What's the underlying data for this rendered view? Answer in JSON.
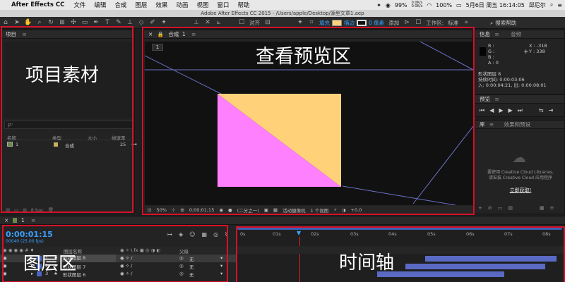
{
  "menubar": {
    "app_name": "After Effects CC",
    "items": [
      "文件",
      "编辑",
      "合成",
      "图层",
      "效果",
      "动画",
      "视图",
      "窗口",
      "帮助"
    ],
    "battery": "99%",
    "net_up": "0.0K/s",
    "net_down": "0.0K/s",
    "battery2": "100%",
    "datetime": "5月6日 周五  16:14:05",
    "user": "邱尼尔"
  },
  "window": {
    "title": "Adobe After Effects CC 2015 - /Users/apple/Desktop/源型文章1.aep"
  },
  "toolbar": {
    "align_label": "对齐",
    "fill_label": "填充",
    "stroke_label": "描边",
    "stroke_px": "0 像素",
    "add_label": "添加",
    "workspace_label": "工作区:",
    "workspace_value": "标准",
    "search_help": "搜索帮助"
  },
  "project": {
    "tab": "项目",
    "search_placeholder": "ρ·",
    "headers": {
      "name": "名称",
      "type": "类型",
      "size": "大小",
      "fps": "帧速率"
    },
    "rows": [
      {
        "name": "1",
        "type": "合成",
        "fps": "25"
      }
    ],
    "bpc": "8 bpc",
    "annotation": "项目素材"
  },
  "viewer": {
    "tab_prefix": "合成",
    "tab_name": "1",
    "comp_chip": "1",
    "annotation": "查看预览区",
    "zoom": "50%",
    "timecode": "0;00;01;15",
    "resolution": "(二分之一)",
    "camera": "活动摄像机",
    "views": "1 个视图",
    "offset": "+0.0",
    "colors": {
      "rect_yellow": "#ffd27a",
      "rect_pink": "#ff80ff",
      "guide": "#6b72c8"
    }
  },
  "info": {
    "tab_info": "信息",
    "tab_audio": "音频",
    "r": "R :",
    "g": "G :",
    "b": "B :",
    "a": "A : 0",
    "x": "X : -318",
    "y": "Y : 338",
    "layer": "形状图层 8",
    "duration": "持续时间: 0:00:03:06",
    "inout": "入: 0:00:04:21, 出: 0:00:08:01"
  },
  "preview": {
    "tab": "预览"
  },
  "library": {
    "tab_lib": "库",
    "tab_effects": "效果和预设",
    "line1": "要使用 Creative Cloud Libraries,",
    "line2": "请安装 Creative Cloud 应用程序",
    "link": "立即获取!"
  },
  "timeline": {
    "tab_name": "1",
    "timecode": "0:00:01:15",
    "fps": "00040 (25.00 fps)",
    "col_name": "图层名称",
    "col_parent": "父级",
    "layers": [
      {
        "num": "1",
        "name": "形状图层 8",
        "parent": "无",
        "color": "#4a66c8"
      },
      {
        "num": "2",
        "name": "形状图层 7",
        "parent": "无",
        "color": "#4a66c8"
      },
      {
        "num": "3",
        "name": "形状图层 6",
        "parent": "无",
        "color": "#4a66c8"
      }
    ],
    "ruler_ticks": [
      "0s",
      "01s",
      "02s",
      "03s",
      "04s",
      "05s",
      "06s",
      "07s",
      "08s"
    ],
    "layer_annotation": "图层区",
    "track_annotation": "时间轴"
  }
}
